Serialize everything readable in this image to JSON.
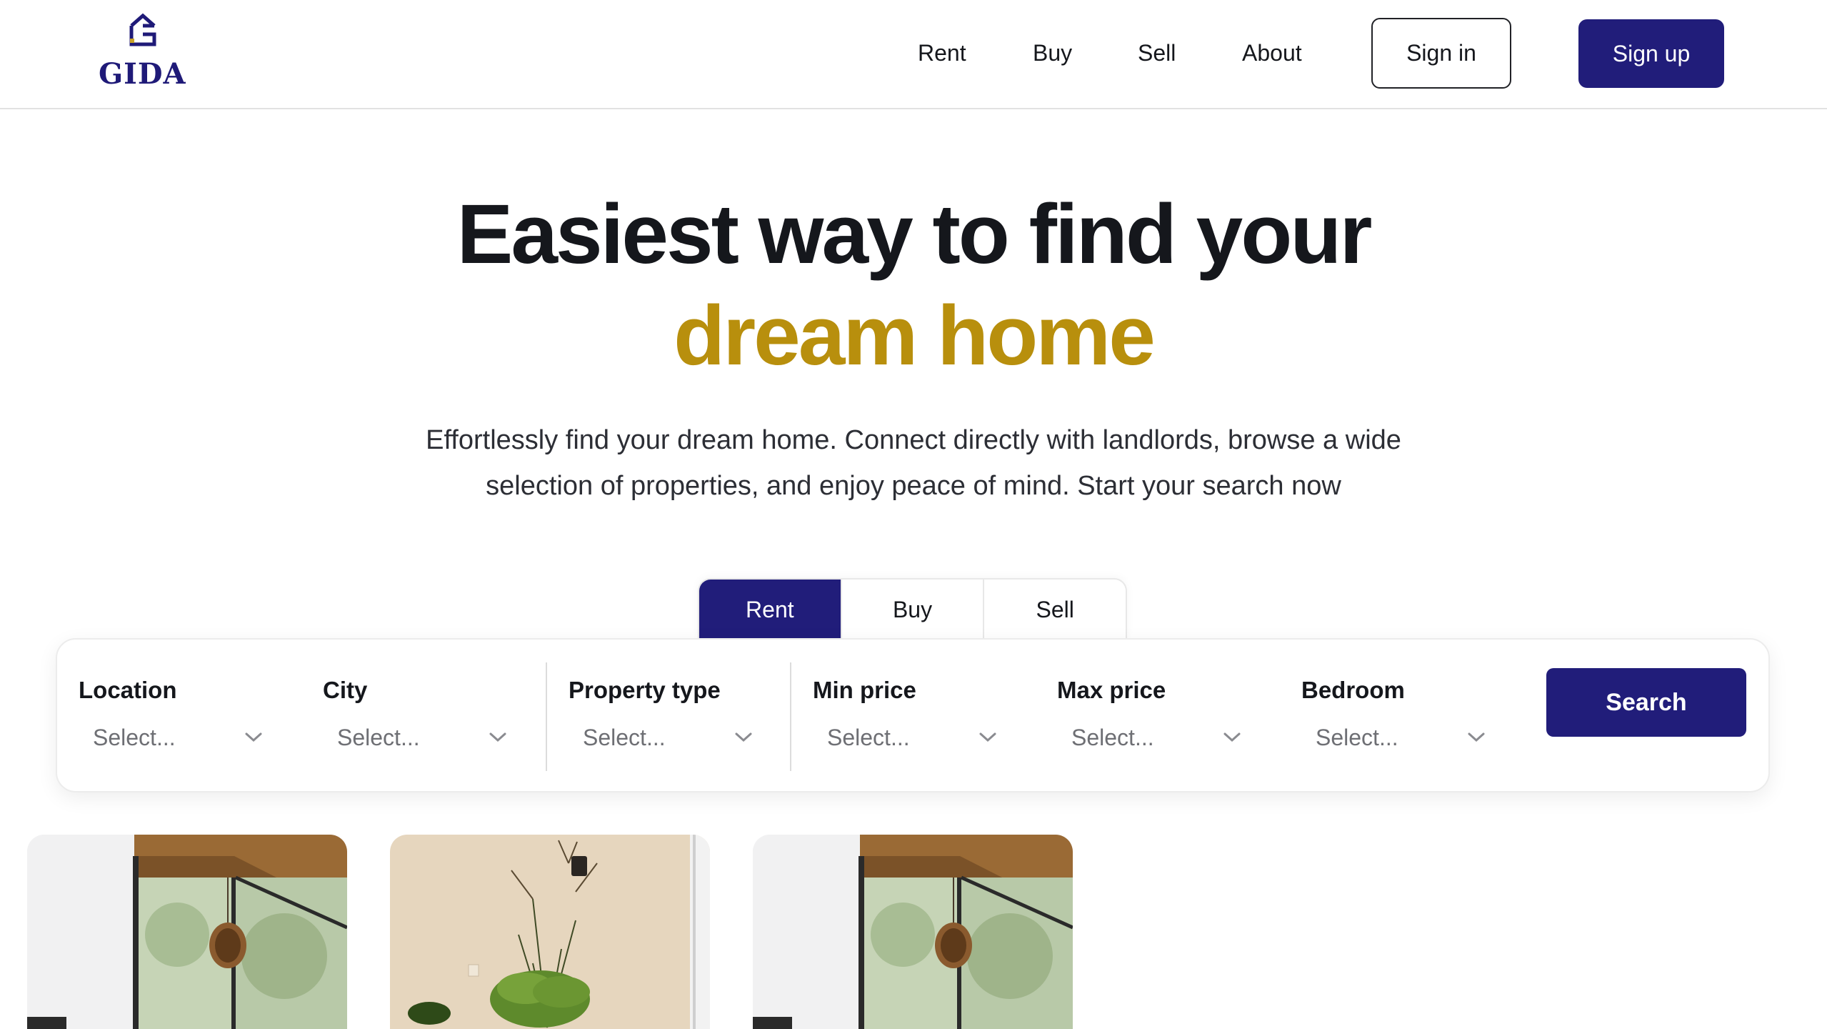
{
  "brand": {
    "name": "GIDA",
    "logo_icon": "house-g-logo-icon",
    "color": "#1f1a78"
  },
  "nav": {
    "links": [
      {
        "label": "Rent"
      },
      {
        "label": "Buy"
      },
      {
        "label": "Sell"
      },
      {
        "label": "About"
      }
    ],
    "sign_in": "Sign in",
    "sign_up": "Sign up"
  },
  "hero": {
    "title_line1": "Easiest way to find your",
    "title_line2": "dream home",
    "subtitle": "Effortlessly find your dream home. Connect directly with landlords, browse a wide selection of properties, and enjoy peace of mind. Start your search now"
  },
  "search": {
    "tabs": [
      {
        "label": "Rent",
        "active": true
      },
      {
        "label": "Buy",
        "active": false
      },
      {
        "label": "Sell",
        "active": false
      }
    ],
    "fields": [
      {
        "label": "Location",
        "value": "Select..."
      },
      {
        "label": "City",
        "value": "Select..."
      },
      {
        "label": "Property type",
        "value": "Select..."
      },
      {
        "label": "Min price",
        "value": "Select..."
      },
      {
        "label": "Max price",
        "value": "Select..."
      },
      {
        "label": "Bedroom",
        "value": "Select..."
      }
    ],
    "button_label": "Search"
  },
  "listings": [
    {
      "image": "room-with-pendant-lamp-photo"
    },
    {
      "image": "room-with-plants-photo"
    },
    {
      "image": "room-with-pendant-lamp-photo"
    }
  ],
  "colors": {
    "primary": "#211d7a",
    "accent_gold": "#b88f0d",
    "text": "#15171c"
  }
}
